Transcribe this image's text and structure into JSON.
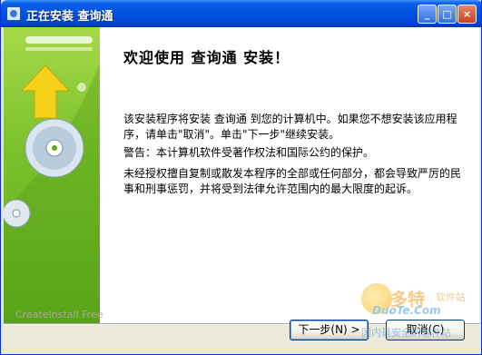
{
  "window": {
    "title": "正在安装 查询通",
    "minimize_glyph": "_",
    "maximize_glyph": "□",
    "close_glyph": "×"
  },
  "wizard": {
    "heading": "欢迎使用 查询通 安装！",
    "paragraphs": [
      "该安装程序将安装 查询通 到您的计算机中。如果您不想安装该应用程序，请单击\"取消\"。单击\"下一步\"继续安装。",
      "警告：本计算机软件受著作权法和国际公约的保护。",
      "未经授权擅自复制或散发本程序的全部或任何部分，都会导致严厉的民事和刑事惩罚，并将受到法律允许范围内的最大限度的起诉。"
    ]
  },
  "footer": {
    "brand": "CreateInstall Free",
    "next_label": "下一步(N) >",
    "cancel_label": "取消(C)"
  },
  "watermark": {
    "logo_text": "多特",
    "sub_text": "软件站",
    "url": "DuoTe.Com",
    "name": "国内最安全的软件站"
  },
  "colors": {
    "titlebar": "#0054e3",
    "sidebar_green": "#7dc22d",
    "arrow_yellow": "#f5d21a"
  },
  "icons": [
    "app-icon",
    "minimize-icon",
    "maximize-icon",
    "close-icon",
    "cd-disc-icon",
    "up-arrow-icon"
  ]
}
